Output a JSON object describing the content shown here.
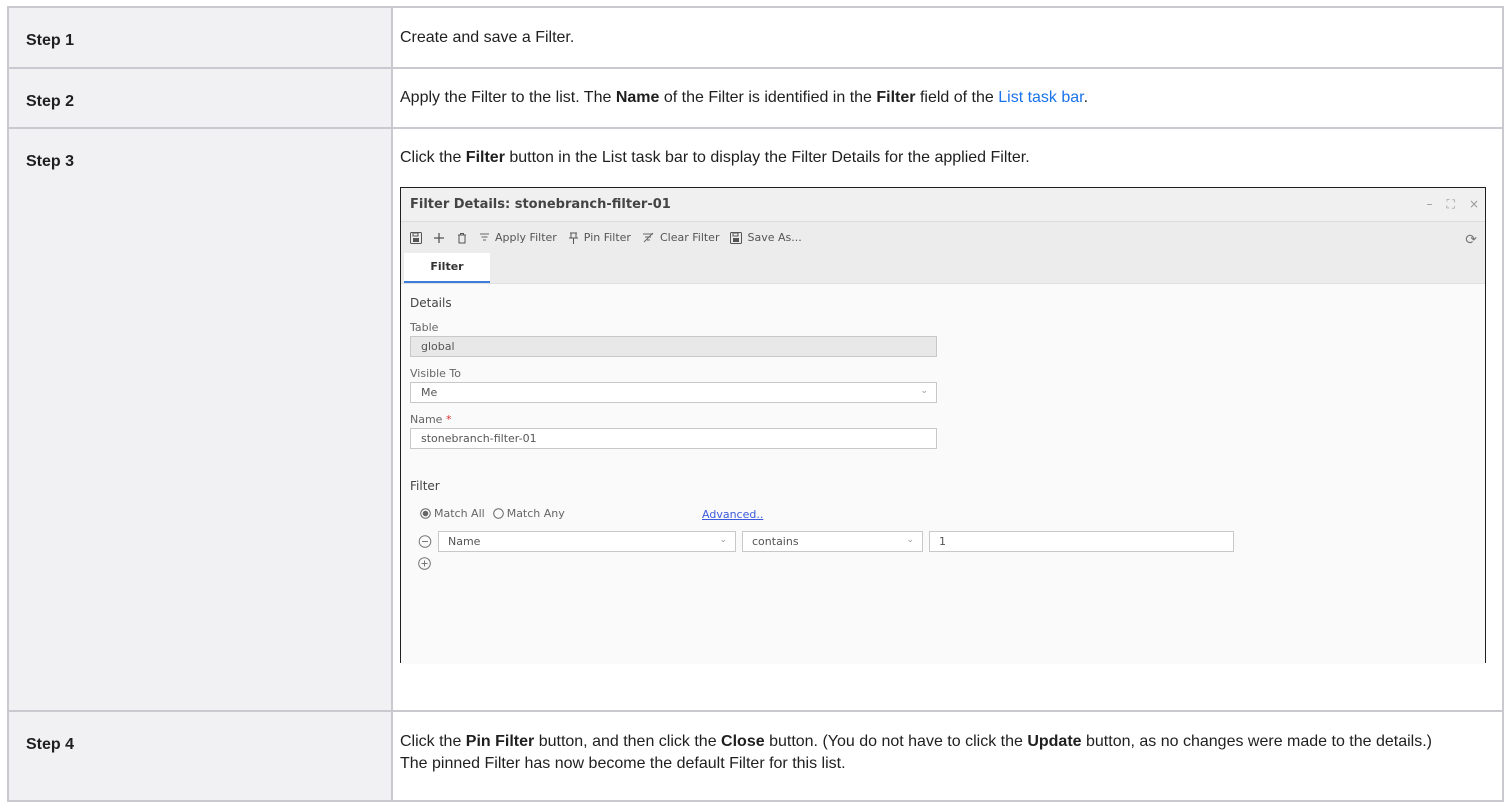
{
  "steps": [
    {
      "label": "Step 1",
      "text": [
        {
          "t": "Create and save a Filter."
        }
      ]
    },
    {
      "label": "Step 2",
      "text": [
        {
          "t": "Apply the Filter to the list. The "
        },
        {
          "t": "Name",
          "b": true
        },
        {
          "t": " of the Filter is identified in the "
        },
        {
          "t": "Filter",
          "b": true
        },
        {
          "t": " field of the "
        },
        {
          "t": "List task bar",
          "link": true
        },
        {
          "t": "."
        }
      ]
    },
    {
      "label": "Step 3",
      "text": [
        {
          "t": "Click the "
        },
        {
          "t": "Filter",
          "b": true
        },
        {
          "t": " button in the List task bar to display the Filter Details for the applied Filter."
        }
      ]
    },
    {
      "label": "Step 4",
      "text": [
        {
          "t": "Click the "
        },
        {
          "t": "Pin Filter",
          "b": true
        },
        {
          "t": " button, and then click the "
        },
        {
          "t": "Close",
          "b": true
        },
        {
          "t": " button. (You do not have to click the "
        },
        {
          "t": "Update",
          "b": true
        },
        {
          "t": " button, as no changes were made to the details.) The pinned Filter has now become the default Filter for this list."
        }
      ]
    }
  ],
  "dialog": {
    "title": "Filter Details: stonebranch-filter-01",
    "window_controls": [
      "–",
      "⛶",
      "×"
    ],
    "toolbar": {
      "save_icon": "save-icon",
      "new_icon": "plus-icon",
      "delete_icon": "trash-icon",
      "apply_filter": "Apply Filter",
      "pin_filter": "Pin Filter",
      "clear_filter": "Clear Filter",
      "save_as": "Save As...",
      "refresh_icon": "refresh-icon"
    },
    "tab": "Filter",
    "details": {
      "section_title": "Details",
      "table_label": "Table",
      "table_value": "global",
      "visible_to_label": "Visible To",
      "visible_to_value": "Me",
      "name_label": "Name",
      "name_required_mark": "*",
      "name_value": "stonebranch-filter-01"
    },
    "filter": {
      "section_title": "Filter",
      "match_all": "Match All",
      "match_any": "Match Any",
      "match_selected": "Match All",
      "advanced": "Advanced..",
      "condition": {
        "field": "Name",
        "operator": "contains",
        "value": "1"
      }
    }
  }
}
